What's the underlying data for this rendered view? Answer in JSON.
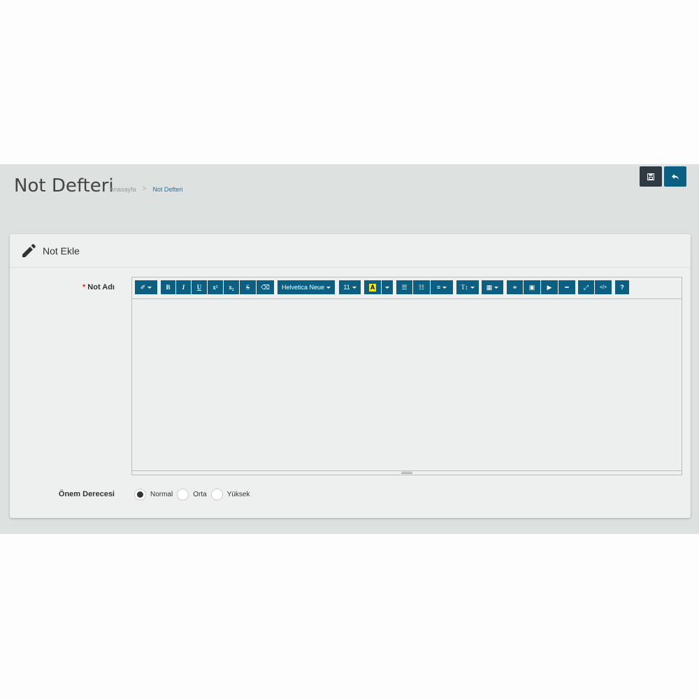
{
  "header": {
    "title": "Not Defteri",
    "breadcrumb": {
      "home": "Anasayfa",
      "separator": ">",
      "current": "Not Defteri"
    },
    "buttons": {
      "save_icon": "floppy-disk-icon",
      "back_icon": "reply-arrow-icon"
    }
  },
  "panel": {
    "title": "Not Ekle",
    "icon": "pencil-icon",
    "fields": {
      "note_name": {
        "required_mark": "*",
        "label": "Not Adı"
      },
      "priority": {
        "label": "Önem Derecesi",
        "options": [
          "Normal",
          "Orta",
          "Yüksek"
        ],
        "selected": "Normal"
      }
    }
  },
  "toolbar": {
    "style": "✐",
    "bold": "B",
    "italic": "I",
    "underline": "U",
    "superscript": "x²",
    "subscript": "x₂",
    "strike": "S",
    "eraser": "⌫",
    "font_name": "Helvetica Neue",
    "font_size": "11",
    "color_letter": "A",
    "ul": "☰",
    "ol": "☷",
    "align": "≡",
    "line_height": "T↕",
    "table": "▦",
    "link": "⚭",
    "picture": "▣",
    "video": "▶",
    "hr": "━",
    "fullscreen": "⤢",
    "code": "</>",
    "help": "?"
  },
  "colors": {
    "primary": "#0a5f82",
    "dark": "#2f3a44",
    "accent_text": "#1e6fa8",
    "required": "#e0262a",
    "highlight": "#f4e21a"
  }
}
